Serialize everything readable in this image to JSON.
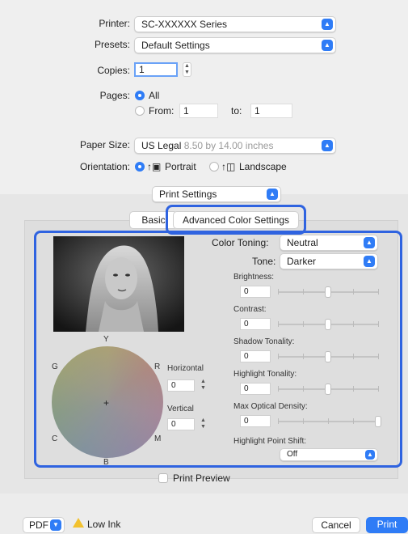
{
  "printer": {
    "label": "Printer:",
    "value": "SC-XXXXXX Series"
  },
  "presets": {
    "label": "Presets:",
    "value": "Default Settings"
  },
  "copies": {
    "label": "Copies:",
    "value": "1"
  },
  "pages": {
    "label": "Pages:",
    "all": "All",
    "from": "From:",
    "from_value": "1",
    "to": "to:",
    "to_value": "1"
  },
  "paper_size": {
    "label": "Paper Size:",
    "value": "US Legal",
    "detail": "8.50 by 14.00 inches"
  },
  "orientation": {
    "label": "Orientation:",
    "portrait": "Portrait",
    "landscape": "Landscape"
  },
  "section": {
    "value": "Print Settings"
  },
  "tabs": {
    "basic": "Basic",
    "advanced": "Advanced Color Settings"
  },
  "color_toning": {
    "label": "Color Toning:",
    "value": "Neutral"
  },
  "tone": {
    "label": "Tone:",
    "value": "Darker"
  },
  "sliders": [
    {
      "label": "Brightness:",
      "value": "0",
      "level": 0.5
    },
    {
      "label": "Contrast:",
      "value": "0",
      "level": 0.5
    },
    {
      "label": "Shadow Tonality:",
      "value": "0",
      "level": 0.5
    },
    {
      "label": "Highlight Tonality:",
      "value": "0",
      "level": 0.5
    },
    {
      "label": "Max Optical Density:",
      "value": "0",
      "level": 1.0
    }
  ],
  "highlight_point_shift": {
    "label": "Highlight Point Shift:",
    "value": "Off"
  },
  "color_wheel": {
    "y": "Y",
    "r": "R",
    "g": "G",
    "c": "C",
    "m": "M",
    "b": "B"
  },
  "horizontal": {
    "label": "Horizontal",
    "value": "0"
  },
  "vertical": {
    "label": "Vertical",
    "value": "0"
  },
  "print_preview": "Print Preview",
  "footer": {
    "pdf": "PDF",
    "low_ink": "Low Ink",
    "cancel": "Cancel",
    "print": "Print"
  },
  "colors": {
    "accent": "#2f7cf6",
    "highlight": "#2f63e0",
    "warning": "#f2c12e"
  }
}
